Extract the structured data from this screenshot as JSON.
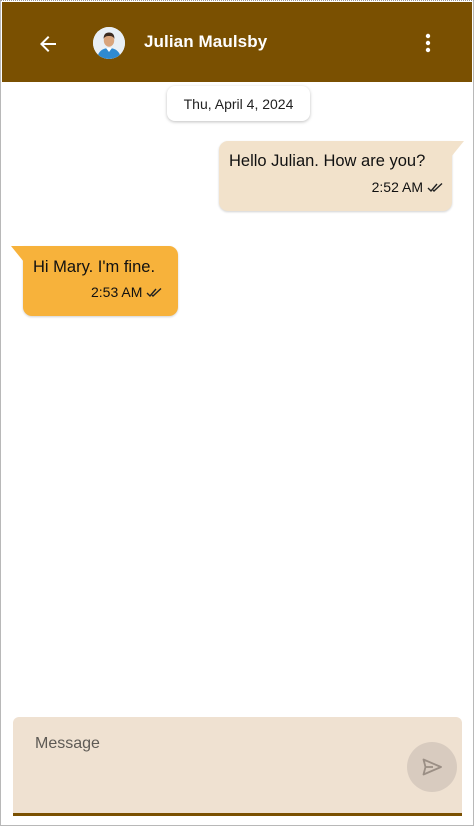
{
  "header": {
    "contact_name": "Julian Maulsby",
    "back_icon": "arrow-left-icon",
    "menu_icon": "more-vertical-icon",
    "background_color": "#7a5001"
  },
  "conversation": {
    "date_label": "Thu, April 4, 2024",
    "messages": [
      {
        "direction": "outgoing",
        "text": "Hello Julian. How are you?",
        "time": "2:52 AM",
        "status_icon": "double-check-icon",
        "bubble_color": "#f2e2cb"
      },
      {
        "direction": "incoming",
        "text": "Hi Mary. I'm fine.",
        "time": "2:53 AM",
        "status_icon": "double-check-icon",
        "bubble_color": "#f7b23b"
      }
    ]
  },
  "composer": {
    "placeholder": "Message",
    "value": "",
    "send_icon": "send-icon",
    "background_color": "#efe1d1"
  }
}
